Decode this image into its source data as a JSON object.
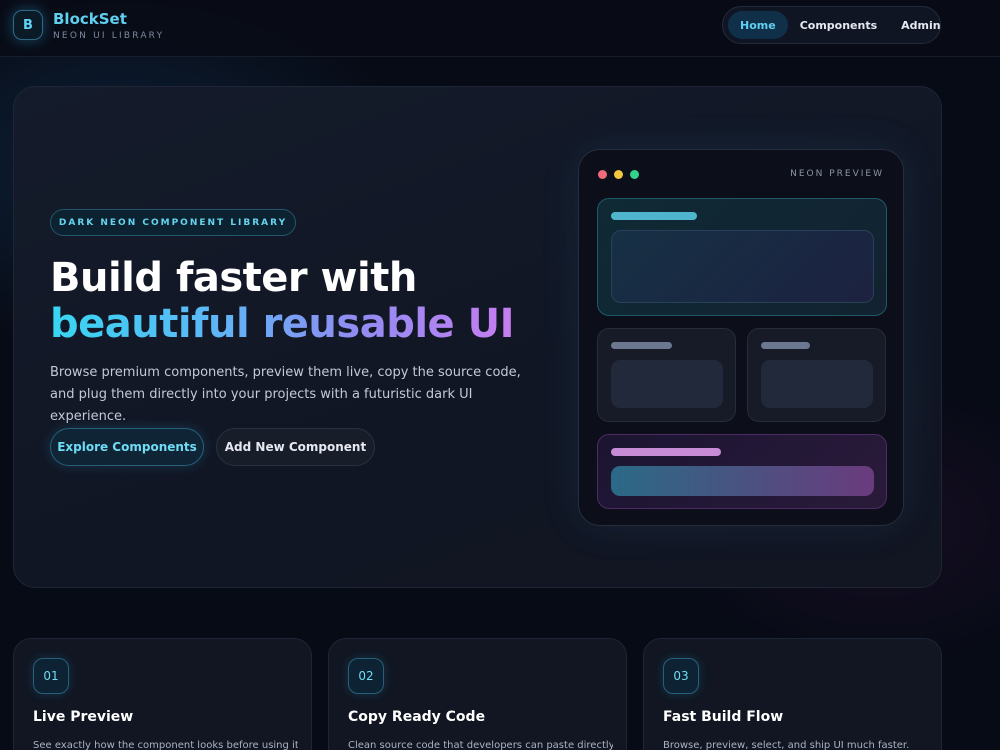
{
  "brand": {
    "logo_letter": "B",
    "name": "BlockSet",
    "subtitle": "NEON UI LIBRARY"
  },
  "nav": {
    "items": [
      {
        "label": "Home",
        "active": true
      },
      {
        "label": "Components",
        "active": false
      },
      {
        "label": "Admin",
        "active": false
      }
    ]
  },
  "hero": {
    "pill": "DARK NEON COMPONENT LIBRARY",
    "title_line1": "Build faster with",
    "title_line2": "beautiful reusable UI",
    "description": "Browse premium components, preview them live, copy the source code, and plug them directly into your projects with a futuristic dark UI experience.",
    "primary_button": "Explore Components",
    "secondary_button": "Add New Component"
  },
  "preview": {
    "label": "NEON PREVIEW"
  },
  "features": [
    {
      "number": "01",
      "title": "Live Preview",
      "description": "See exactly how the component looks before using it."
    },
    {
      "number": "02",
      "title": "Copy Ready Code",
      "description": "Clean source code that developers can paste directly."
    },
    {
      "number": "03",
      "title": "Fast Build Flow",
      "description": "Browse, preview, select, and ship UI much faster."
    }
  ],
  "colors": {
    "accent": "#5fd0f0",
    "background": "#070b16",
    "gradient_end": "#c77df0"
  }
}
